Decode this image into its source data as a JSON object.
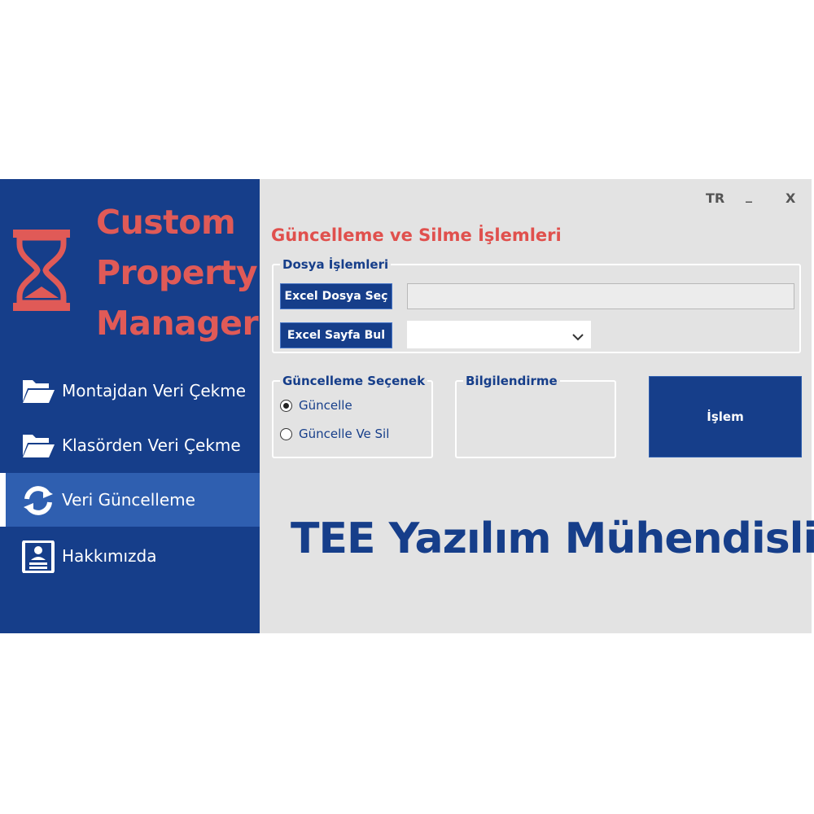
{
  "sidebar": {
    "logo_lines": [
      "Custom",
      "Property",
      "Manager"
    ],
    "items": [
      {
        "label": "Montajdan Veri Çekme",
        "icon": "folder-open-icon"
      },
      {
        "label": "Klasörden Veri Çekme",
        "icon": "folder-open-icon"
      },
      {
        "label": "Veri Güncelleme",
        "icon": "refresh-icon",
        "active": true
      },
      {
        "label": "Hakkımızda",
        "icon": "contact-card-icon"
      }
    ]
  },
  "window": {
    "lang": "TR",
    "minimize": "_",
    "close": "X"
  },
  "main": {
    "title": "Güncelleme ve Silme İşlemleri",
    "file_group": {
      "legend": "Dosya İşlemleri",
      "select_file_button": "Excel Dosya Seç",
      "file_path_value": "",
      "find_sheet_button": "Excel Sayfa Bul",
      "sheet_selected": ""
    },
    "options_group": {
      "legend": "Güncelleme Seçenek",
      "options": [
        "Güncelle",
        "Güncelle Ve Sil"
      ],
      "selected": "Güncelle"
    },
    "info_group": {
      "legend": "Bilgilendirme"
    },
    "process_button": "İşlem",
    "brand": "TEE Yazılım Mühendislik"
  },
  "colors": {
    "sidebar_bg": "#163e8a",
    "active_item": "#2f5fb0",
    "accent_red": "#e05a57",
    "content_bg": "#e3e3e3"
  }
}
